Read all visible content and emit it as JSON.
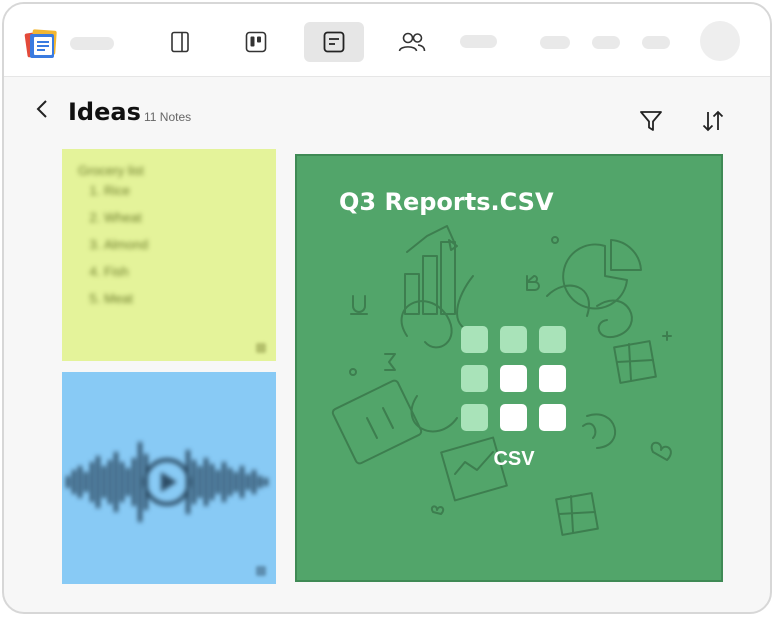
{
  "header": {
    "title": "Ideas",
    "count": "11 Notes"
  },
  "icons": {
    "nav": [
      "panel-icon",
      "board-icon",
      "note-icon",
      "people-icon"
    ],
    "filter": "filter-icon",
    "sort": "sort-icon",
    "back": "chevron-left-icon"
  },
  "notes": {
    "grocery": {
      "title": "Grocery list",
      "items": [
        "Rice",
        "Wheat",
        "Almond",
        "Fish",
        "Meat"
      ]
    },
    "audio": {
      "type": "audio-waveform"
    },
    "csv": {
      "title": "Q3 Reports.CSV",
      "label": "CSV"
    }
  },
  "colors": {
    "yellow_note": "#e4f39a",
    "blue_note": "#88caf5",
    "csv_card": "#52a56a"
  }
}
